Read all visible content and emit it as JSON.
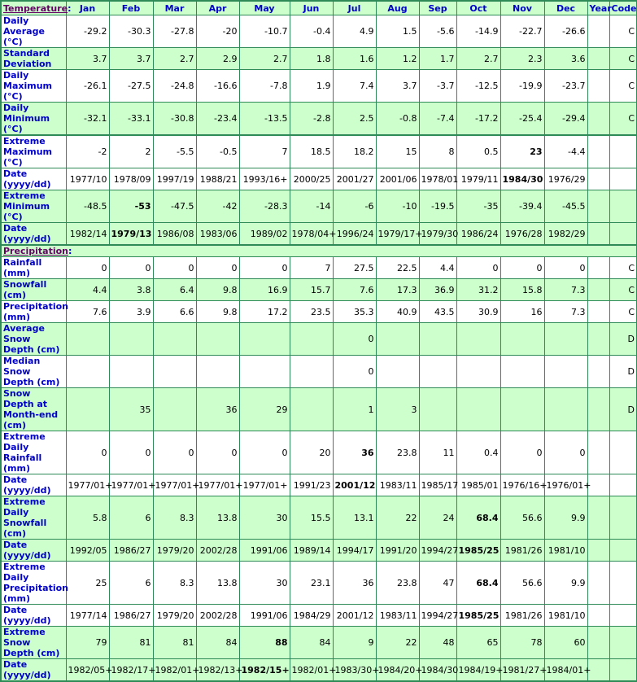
{
  "header": {
    "section_temperature": "Temperature",
    "colon": ":",
    "months": [
      "Jan",
      "Feb",
      "Mar",
      "Apr",
      "May",
      "Jun",
      "Jul",
      "Aug",
      "Sep",
      "Oct",
      "Nov",
      "Dec"
    ],
    "year": "Year",
    "code": "Code"
  },
  "precipitation_section": "Precipitation",
  "temperature_rows": [
    {
      "label": "Daily Average (°C)",
      "values": [
        "-29.2",
        "-30.3",
        "-27.8",
        "-20",
        "-10.7",
        "-0.4",
        "4.9",
        "1.5",
        "-5.6",
        "-14.9",
        "-22.7",
        "-26.6"
      ],
      "bold": [],
      "year": "",
      "code": "C",
      "shade": "w"
    },
    {
      "label": "Standard Deviation",
      "values": [
        "3.7",
        "3.7",
        "2.7",
        "2.9",
        "2.7",
        "1.8",
        "1.6",
        "1.2",
        "1.7",
        "2.7",
        "2.3",
        "3.6"
      ],
      "bold": [],
      "year": "",
      "code": "C",
      "shade": "g"
    },
    {
      "label": "Daily Maximum (°C)",
      "values": [
        "-26.1",
        "-27.5",
        "-24.8",
        "-16.6",
        "-7.8",
        "1.9",
        "7.4",
        "3.7",
        "-3.7",
        "-12.5",
        "-19.9",
        "-23.7"
      ],
      "bold": [],
      "year": "",
      "code": "C",
      "shade": "w"
    },
    {
      "label": "Daily Minimum (°C)",
      "values": [
        "-32.1",
        "-33.1",
        "-30.8",
        "-23.4",
        "-13.5",
        "-2.8",
        "2.5",
        "-0.8",
        "-7.4",
        "-17.2",
        "-25.4",
        "-29.4"
      ],
      "bold": [],
      "year": "",
      "code": "C",
      "shade": "g"
    },
    {
      "label": "Extreme Maximum (°C)",
      "values": [
        "-2",
        "2",
        "-5.5",
        "-0.5",
        "7",
        "18.5",
        "18.2",
        "15",
        "8",
        "0.5",
        "23",
        "-4.4"
      ],
      "bold": [
        10
      ],
      "year": "",
      "code": "",
      "shade": "w",
      "sep": true
    },
    {
      "label": "Date (yyyy/dd)",
      "values": [
        "1977/10",
        "1978/09",
        "1997/19",
        "1988/21",
        "1993/16+",
        "2000/25",
        "2001/27",
        "2001/06",
        "1978/01",
        "1979/11",
        "1984/30",
        "1976/29"
      ],
      "bold": [
        10
      ],
      "year": "",
      "code": "",
      "shade": "w"
    },
    {
      "label": "Extreme Minimum (°C)",
      "values": [
        "-48.5",
        "-53",
        "-47.5",
        "-42",
        "-28.3",
        "-14",
        "-6",
        "-10",
        "-19.5",
        "-35",
        "-39.4",
        "-45.5"
      ],
      "bold": [
        1
      ],
      "year": "",
      "code": "",
      "shade": "g"
    },
    {
      "label": "Date (yyyy/dd)",
      "values": [
        "1982/14",
        "1979/13",
        "1986/08",
        "1983/06",
        "1989/02",
        "1978/04+",
        "1996/24",
        "1979/17+",
        "1979/30",
        "1986/24",
        "1976/28",
        "1982/29"
      ],
      "bold": [
        1
      ],
      "year": "",
      "code": "",
      "shade": "g"
    }
  ],
  "precipitation_rows": [
    {
      "label": "Rainfall (mm)",
      "values": [
        "0",
        "0",
        "0",
        "0",
        "0",
        "7",
        "27.5",
        "22.5",
        "4.4",
        "0",
        "0",
        "0"
      ],
      "bold": [],
      "year": "",
      "code": "C",
      "shade": "w"
    },
    {
      "label": "Snowfall (cm)",
      "values": [
        "4.4",
        "3.8",
        "6.4",
        "9.8",
        "16.9",
        "15.7",
        "7.6",
        "17.3",
        "36.9",
        "31.2",
        "15.8",
        "7.3"
      ],
      "bold": [],
      "year": "",
      "code": "C",
      "shade": "g"
    },
    {
      "label": "Precipitation (mm)",
      "values": [
        "7.6",
        "3.9",
        "6.6",
        "9.8",
        "17.2",
        "23.5",
        "35.3",
        "40.9",
        "43.5",
        "30.9",
        "16",
        "7.3"
      ],
      "bold": [],
      "year": "",
      "code": "C",
      "shade": "w"
    },
    {
      "label": "Average Snow Depth (cm)",
      "values": [
        "",
        "",
        "",
        "",
        "",
        "",
        "0",
        "",
        "",
        "",
        "",
        ""
      ],
      "bold": [],
      "year": "",
      "code": "D",
      "shade": "g"
    },
    {
      "label": "Median Snow Depth (cm)",
      "values": [
        "",
        "",
        "",
        "",
        "",
        "",
        "0",
        "",
        "",
        "",
        "",
        ""
      ],
      "bold": [],
      "year": "",
      "code": "D",
      "shade": "w"
    },
    {
      "label": "Snow Depth at Month-end (cm)",
      "values": [
        "",
        "35",
        "",
        "36",
        "29",
        "",
        "1",
        "3",
        "",
        "",
        "",
        ""
      ],
      "bold": [],
      "year": "",
      "code": "D",
      "shade": "g"
    },
    {
      "label": "Extreme Daily Rainfall (mm)",
      "values": [
        "0",
        "0",
        "0",
        "0",
        "0",
        "20",
        "36",
        "23.8",
        "11",
        "0.4",
        "0",
        "0"
      ],
      "bold": [
        6
      ],
      "year": "",
      "code": "",
      "shade": "w"
    },
    {
      "label": "Date (yyyy/dd)",
      "values": [
        "1977/01+",
        "1977/01+",
        "1977/01+",
        "1977/01+",
        "1977/01+",
        "1991/23",
        "2001/12",
        "1983/11",
        "1985/17",
        "1985/01",
        "1976/16+",
        "1976/01+"
      ],
      "bold": [
        6
      ],
      "year": "",
      "code": "",
      "shade": "w"
    },
    {
      "label": "Extreme Daily Snowfall (cm)",
      "values": [
        "5.8",
        "6",
        "8.3",
        "13.8",
        "30",
        "15.5",
        "13.1",
        "22",
        "24",
        "68.4",
        "56.6",
        "9.9"
      ],
      "bold": [
        9
      ],
      "year": "",
      "code": "",
      "shade": "g"
    },
    {
      "label": "Date (yyyy/dd)",
      "values": [
        "1992/05",
        "1986/27",
        "1979/20",
        "2002/28",
        "1991/06",
        "1989/14",
        "1994/17",
        "1991/20",
        "1994/27",
        "1985/25",
        "1981/26",
        "1981/10"
      ],
      "bold": [
        9
      ],
      "year": "",
      "code": "",
      "shade": "g"
    },
    {
      "label": "Extreme Daily Precipitation (mm)",
      "values": [
        "25",
        "6",
        "8.3",
        "13.8",
        "30",
        "23.1",
        "36",
        "23.8",
        "47",
        "68.4",
        "56.6",
        "9.9"
      ],
      "bold": [
        9
      ],
      "year": "",
      "code": "",
      "shade": "w"
    },
    {
      "label": "Date (yyyy/dd)",
      "values": [
        "1977/14",
        "1986/27",
        "1979/20",
        "2002/28",
        "1991/06",
        "1984/29",
        "2001/12",
        "1983/11",
        "1994/27",
        "1985/25",
        "1981/26",
        "1981/10"
      ],
      "bold": [
        9
      ],
      "year": "",
      "code": "",
      "shade": "w"
    },
    {
      "label": "Extreme Snow Depth (cm)",
      "values": [
        "79",
        "81",
        "81",
        "84",
        "88",
        "84",
        "9",
        "22",
        "48",
        "65",
        "78",
        "60"
      ],
      "bold": [
        4
      ],
      "year": "",
      "code": "",
      "shade": "g"
    },
    {
      "label": "Date (yyyy/dd)",
      "values": [
        "1982/05+",
        "1982/17+",
        "1982/01+",
        "1982/13+",
        "1982/15+",
        "1982/01+",
        "1983/30+",
        "1984/20+",
        "1984/30",
        "1984/19+",
        "1981/27+",
        "1984/01+"
      ],
      "bold": [
        4
      ],
      "year": "",
      "code": "",
      "shade": "g"
    }
  ]
}
